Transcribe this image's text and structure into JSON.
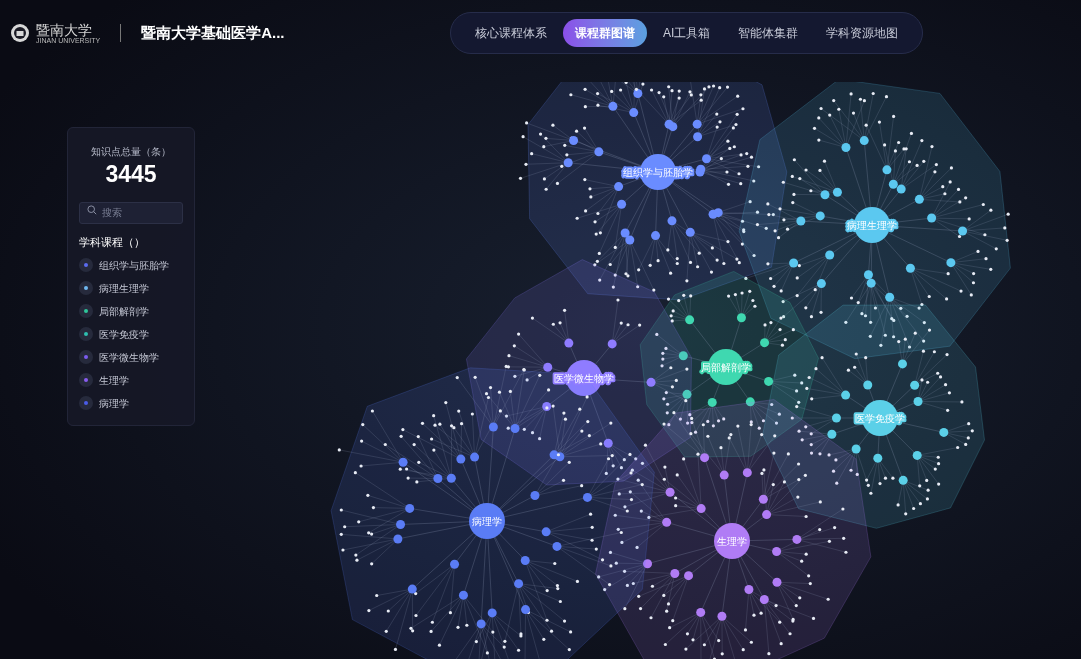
{
  "header": {
    "logo": {
      "name": "暨南大学",
      "subtitle": "JINAN UNIVERSITY"
    },
    "title": "暨南大学基础医学A..."
  },
  "nav": {
    "tabs": [
      {
        "label": "核心课程体系",
        "selected": false
      },
      {
        "label": "课程群图谱",
        "selected": true
      },
      {
        "label": "AI工具箱",
        "selected": false
      },
      {
        "label": "智能体集群",
        "selected": false
      },
      {
        "label": "学科资源地图",
        "selected": false
      }
    ]
  },
  "stats_panel": {
    "label": "知识点总量（条）",
    "value": "3445",
    "search": {
      "placeholder": "搜索"
    },
    "section_title": "学科课程（）",
    "courses": [
      {
        "label": "组织学与胚胎学",
        "color": "#5b6cf0"
      },
      {
        "label": "病理生理学",
        "color": "#6fb8f0"
      },
      {
        "label": "局部解剖学",
        "color": "#2fc69a"
      },
      {
        "label": "医学免疫学",
        "color": "#2fbfb0"
      },
      {
        "label": "医学微生物学",
        "color": "#7b5cf0"
      },
      {
        "label": "生理学",
        "color": "#8a5cf0"
      },
      {
        "label": "病理学",
        "color": "#4a5ce8"
      }
    ]
  },
  "graph": {
    "clusters": [
      {
        "label": "组织学与胚胎学",
        "color": "#6a8cff"
      },
      {
        "label": "病理生理学",
        "color": "#5bc8f0"
      },
      {
        "label": "局部解剖学",
        "color": "#3fd8b0"
      },
      {
        "label": "医学免疫学",
        "color": "#5bd0e8"
      },
      {
        "label": "医学微生物学",
        "color": "#8f7cff"
      },
      {
        "label": "生理学",
        "color": "#b07cf5"
      },
      {
        "label": "病理学",
        "color": "#5a7cf5"
      }
    ]
  }
}
